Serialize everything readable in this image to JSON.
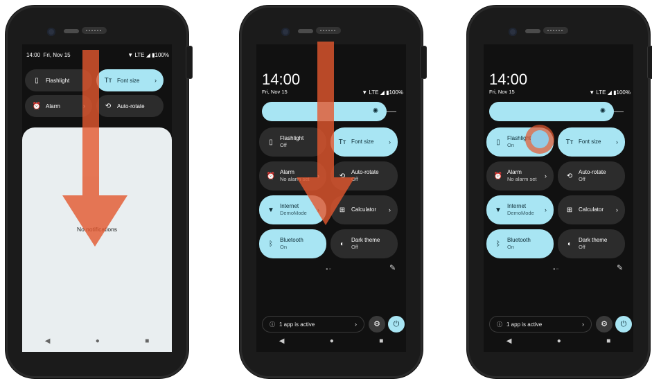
{
  "colors": {
    "accent": "#a8e5f3",
    "tile_off": "#2c2c2c",
    "arrow": "#e4572e",
    "panel_bg": "#e9eef0"
  },
  "phone1": {
    "status": {
      "time": "14:00",
      "date": "Fri, Nov 15",
      "network": "LTE",
      "battery": "100%"
    },
    "tiles": [
      {
        "label": "Flashlight",
        "icon": "flashlight-icon"
      },
      {
        "label": "Font size",
        "icon": "font-size-icon"
      },
      {
        "label": "Alarm",
        "icon": "alarm-icon"
      },
      {
        "label": "Auto-rotate",
        "icon": "auto-rotate-icon"
      }
    ],
    "notifications_message": "No notifications"
  },
  "phone2": {
    "clock": "14:00",
    "date": "Fri, Nov 15",
    "status": {
      "network": "LTE",
      "battery": "100%"
    },
    "tiles": [
      {
        "label": "Flashlight",
        "sub": "Off",
        "icon": "flashlight-icon"
      },
      {
        "label": "Font size",
        "sub": "",
        "icon": "font-size-icon"
      },
      {
        "label": "Alarm",
        "sub": "No alarm set",
        "icon": "alarm-icon"
      },
      {
        "label": "Auto-rotate",
        "sub": "Off",
        "icon": "auto-rotate-icon"
      },
      {
        "label": "Internet",
        "sub": "DemoMode",
        "icon": "wifi-icon"
      },
      {
        "label": "Calculator",
        "sub": "",
        "icon": "calculator-icon"
      },
      {
        "label": "Bluetooth",
        "sub": "On",
        "icon": "bluetooth-icon"
      },
      {
        "label": "Dark theme",
        "sub": "Off",
        "icon": "dark-theme-icon"
      }
    ],
    "active_apps": "1 app is active"
  },
  "phone3": {
    "clock": "14:00",
    "date": "Fri, Nov 15",
    "status": {
      "network": "LTE",
      "battery": "100%"
    },
    "tiles": [
      {
        "label": "Flashlight",
        "sub": "On",
        "icon": "flashlight-icon"
      },
      {
        "label": "Font size",
        "sub": "",
        "icon": "font-size-icon"
      },
      {
        "label": "Alarm",
        "sub": "No alarm set",
        "icon": "alarm-icon"
      },
      {
        "label": "Auto-rotate",
        "sub": "Off",
        "icon": "auto-rotate-icon"
      },
      {
        "label": "Internet",
        "sub": "DemoMode",
        "icon": "wifi-icon"
      },
      {
        "label": "Calculator",
        "sub": "",
        "icon": "calculator-icon"
      },
      {
        "label": "Bluetooth",
        "sub": "On",
        "icon": "bluetooth-icon"
      },
      {
        "label": "Dark theme",
        "sub": "Off",
        "icon": "dark-theme-icon"
      }
    ],
    "active_apps": "1 app is active"
  }
}
